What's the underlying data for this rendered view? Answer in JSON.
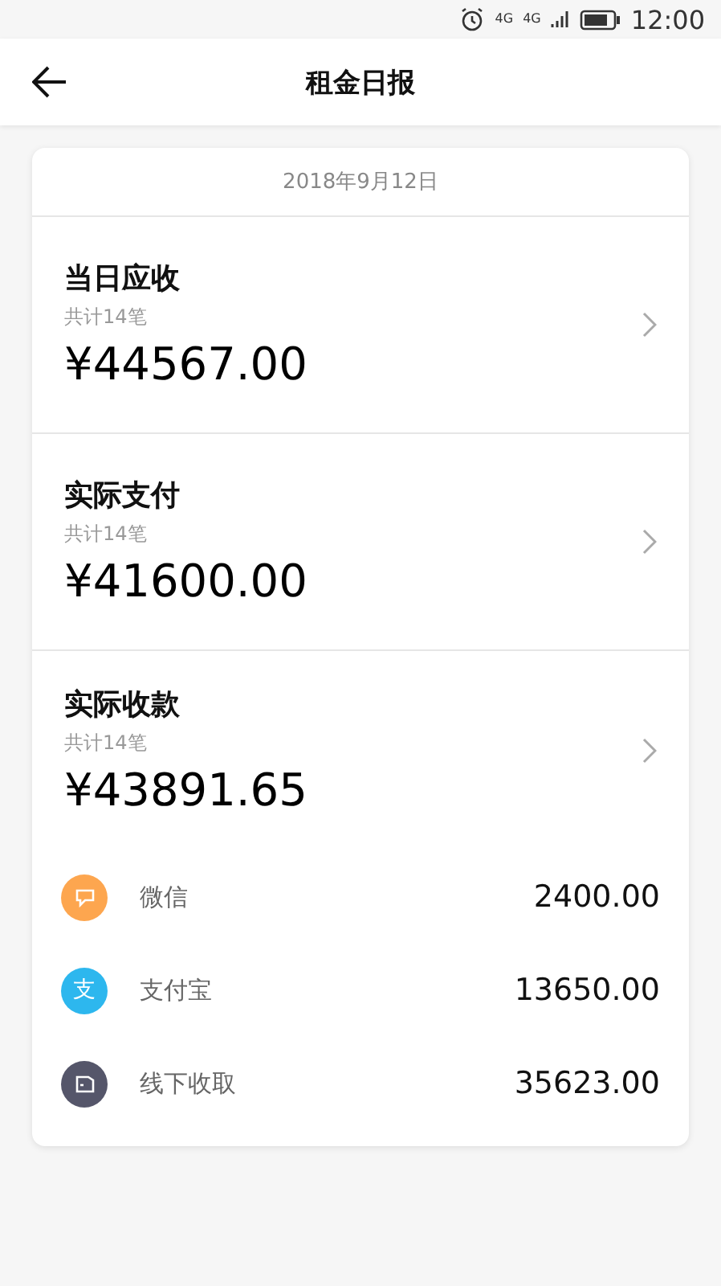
{
  "status_bar": {
    "network_1": "4G",
    "network_2": "4G",
    "time": "12:00"
  },
  "header": {
    "title": "租金日报"
  },
  "report": {
    "date": "2018年9月12日",
    "sections": [
      {
        "title": "当日应收",
        "count": "共计14笔",
        "amount": "¥44567.00"
      },
      {
        "title": "实际支付",
        "count": "共计14笔",
        "amount": "¥41600.00"
      },
      {
        "title": "实际收款",
        "count": "共计14笔",
        "amount": "¥43891.65"
      }
    ],
    "channels": [
      {
        "kind": "chat",
        "name": "微信",
        "amount": "2400.00",
        "color": "#fda64f"
      },
      {
        "kind": "glyph",
        "glyph": "支",
        "name": "支付宝",
        "amount": "13650.00",
        "color": "#2db7ee"
      },
      {
        "kind": "wallet",
        "name": "线下收取",
        "amount": "35623.00",
        "color": "#55566a"
      }
    ]
  }
}
